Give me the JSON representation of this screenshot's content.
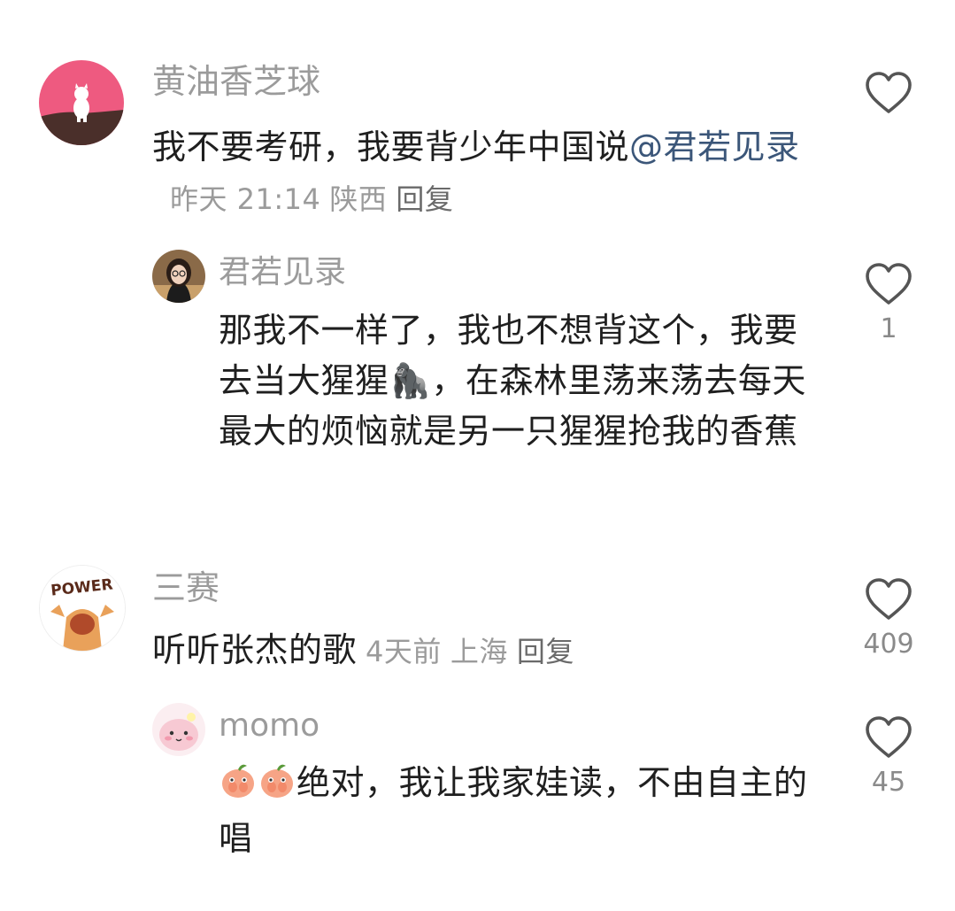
{
  "comments": [
    {
      "user": "黄油香芝球",
      "text_before": "我不要考研，我要背少年中国说",
      "mention": "@君若见录",
      "time": "昨天 21:14",
      "location": "陕西",
      "reply": "回复",
      "likes": "",
      "avatar_icon": "white-cat-avatar",
      "replies": [
        {
          "user": "君若见录",
          "text": "那我不一样了，我也不想背这个，我要去当大猩猩🦍，在森林里荡来荡去每天最大的烦恼就是另一只猩猩抢我的香蕉",
          "likes": "1",
          "avatar_icon": "girl-portrait-avatar"
        }
      ]
    },
    {
      "user": "三赛",
      "text": "听听张杰的歌",
      "time": "4天前",
      "location": "上海",
      "reply": "回复",
      "likes": "409",
      "avatar_icon": "power-cartoon-avatar",
      "replies": [
        {
          "user": "momo",
          "text": "绝对，我让我家娃读，不由自主的唱",
          "emoji_count": 2,
          "emoji_icon": "shy-peach-emoji",
          "likes": "45",
          "avatar_icon": "pink-blob-avatar"
        }
      ]
    }
  ],
  "colors": {
    "username": "#9b9b9b",
    "body_text": "#1f1f1f",
    "mention": "#3b5679",
    "meta": "#9b9b9b",
    "heart_outline": "#555555"
  }
}
